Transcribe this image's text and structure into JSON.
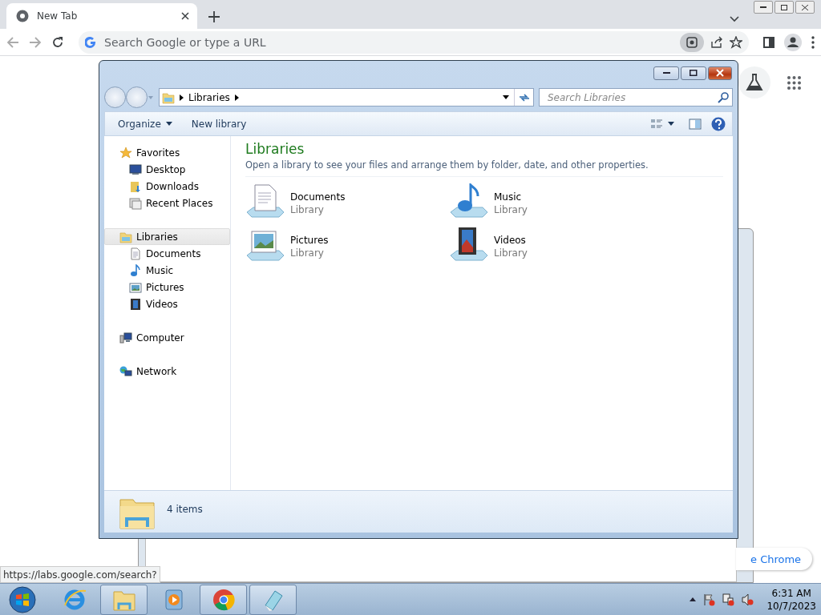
{
  "browser": {
    "tabs": [
      {
        "title": "New Tab",
        "selected": true
      }
    ],
    "address": {
      "placeholder": "Search Google or type a URL"
    },
    "status_url": "https://labs.google.com/search?",
    "promo_text": "e Chrome"
  },
  "explorer": {
    "breadcrumb": [
      "Libraries"
    ],
    "search": {
      "placeholder": "Search Libraries"
    },
    "toolbar": [
      {
        "label": "Organize",
        "dropdown": true
      },
      {
        "label": "New library",
        "dropdown": false
      }
    ],
    "sidebar": [
      {
        "label": "Favorites",
        "kind": "favorites",
        "selected": false,
        "children": [
          {
            "label": "Desktop",
            "kind": "desktop",
            "selected": false
          },
          {
            "label": "Downloads",
            "kind": "downloads",
            "selected": false
          },
          {
            "label": "Recent Places",
            "kind": "recent",
            "selected": false
          }
        ]
      },
      {
        "label": "Libraries",
        "kind": "libraries",
        "selected": true,
        "children": [
          {
            "label": "Documents",
            "kind": "documents",
            "selected": false
          },
          {
            "label": "Music",
            "kind": "music",
            "selected": false
          },
          {
            "label": "Pictures",
            "kind": "pictures",
            "selected": false
          },
          {
            "label": "Videos",
            "kind": "videos",
            "selected": false
          }
        ]
      },
      {
        "label": "Computer",
        "kind": "computer",
        "selected": false
      },
      {
        "label": "Network",
        "kind": "network",
        "selected": false
      }
    ],
    "heading": "Libraries",
    "description": "Open a library to see your files and arrange them by folder, date, and other properties.",
    "items": [
      {
        "name": "Documents",
        "type": "Library",
        "kind": "documents"
      },
      {
        "name": "Music",
        "type": "Library",
        "kind": "music"
      },
      {
        "name": "Pictures",
        "type": "Library",
        "kind": "pictures"
      },
      {
        "name": "Videos",
        "type": "Library",
        "kind": "videos"
      }
    ],
    "status": "4 items"
  },
  "taskbar": {
    "apps": [
      {
        "kind": "ie",
        "open": false
      },
      {
        "kind": "explorer",
        "open": true
      },
      {
        "kind": "media",
        "open": false
      },
      {
        "kind": "chrome",
        "open": true
      },
      {
        "kind": "notepad",
        "open": true
      }
    ],
    "time": "6:31 AM",
    "date": "10/7/2023"
  }
}
